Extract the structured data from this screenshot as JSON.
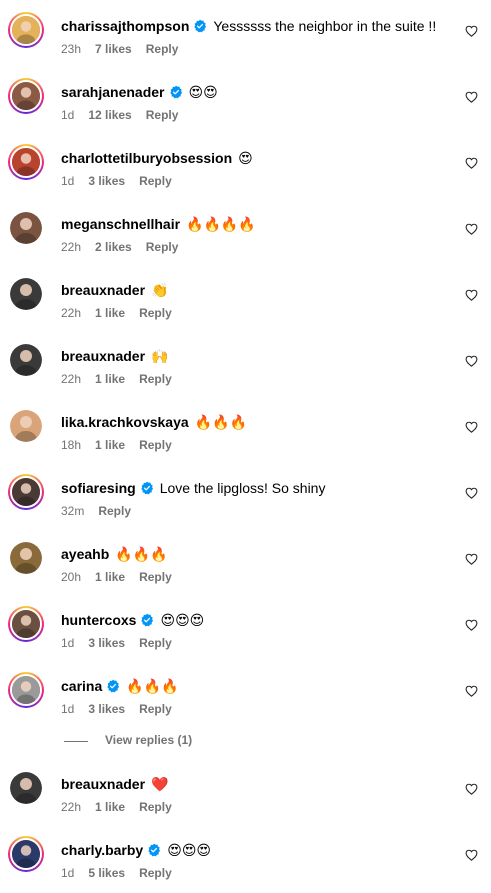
{
  "comments_before": [
    {
      "username": "charissajthompson",
      "verified": true,
      "text": "Yessssss the neighbor in the suite !!",
      "time": "23h",
      "likes": "7 likes",
      "reply": "Reply",
      "story": true,
      "avatar_color": "#e3b25a"
    },
    {
      "username": "sarahjanenader",
      "verified": true,
      "text": "😍😍",
      "time": "1d",
      "likes": "12 likes",
      "reply": "Reply",
      "story": true,
      "avatar_color": "#8a5a44"
    },
    {
      "username": "charlottetilburyobsession",
      "verified": false,
      "text": "😍",
      "time": "1d",
      "likes": "3 likes",
      "reply": "Reply",
      "story": true,
      "avatar_color": "#b8432f"
    },
    {
      "username": "meganschnellhair",
      "verified": false,
      "text": "🔥🔥🔥🔥",
      "time": "22h",
      "likes": "2 likes",
      "reply": "Reply",
      "story": false,
      "avatar_color": "#7a5440"
    },
    {
      "username": "breauxnader",
      "verified": false,
      "text": "👏",
      "time": "22h",
      "likes": "1 like",
      "reply": "Reply",
      "story": false,
      "avatar_color": "#3a3a3a"
    },
    {
      "username": "breauxnader",
      "verified": false,
      "text": "🙌",
      "time": "22h",
      "likes": "1 like",
      "reply": "Reply",
      "story": false,
      "avatar_color": "#3a3a3a"
    },
    {
      "username": "lika.krachkovskaya",
      "verified": false,
      "text": "🔥🔥🔥",
      "time": "18h",
      "likes": "1 like",
      "reply": "Reply",
      "story": false,
      "avatar_color": "#d9a47a"
    },
    {
      "username": "sofiaresing",
      "verified": true,
      "text": "Love the lipgloss! So shiny",
      "time": "32m",
      "likes": "",
      "reply": "Reply",
      "story": true,
      "avatar_color": "#4a3a36"
    },
    {
      "username": "ayeahb",
      "verified": false,
      "text": "🔥🔥🔥",
      "time": "20h",
      "likes": "1 like",
      "reply": "Reply",
      "story": false,
      "avatar_color": "#8a6a3a"
    },
    {
      "username": "huntercoxs",
      "verified": true,
      "text": "😍😍😍",
      "time": "1d",
      "likes": "3 likes",
      "reply": "Reply",
      "story": true,
      "avatar_color": "#6a5040"
    },
    {
      "username": "carina",
      "verified": true,
      "text": "🔥🔥🔥",
      "time": "1d",
      "likes": "3 likes",
      "reply": "Reply",
      "story": true,
      "avatar_color": "#9a9a9a"
    }
  ],
  "view_replies": "View replies (1)",
  "comments_after": [
    {
      "username": "breauxnader",
      "verified": false,
      "text": "❤️",
      "time": "22h",
      "likes": "1 like",
      "reply": "Reply",
      "story": false,
      "avatar_color": "#3a3a3a"
    },
    {
      "username": "charly.barby",
      "verified": true,
      "text": "😍😍😍",
      "time": "1d",
      "likes": "5 likes",
      "reply": "Reply",
      "story": true,
      "avatar_color": "#2a3a6a"
    }
  ],
  "icons": {
    "verified": "verified-badge-icon",
    "heart": "heart-outline-icon"
  },
  "colors": {
    "verified": "#0095f6",
    "meta": "#737373"
  }
}
